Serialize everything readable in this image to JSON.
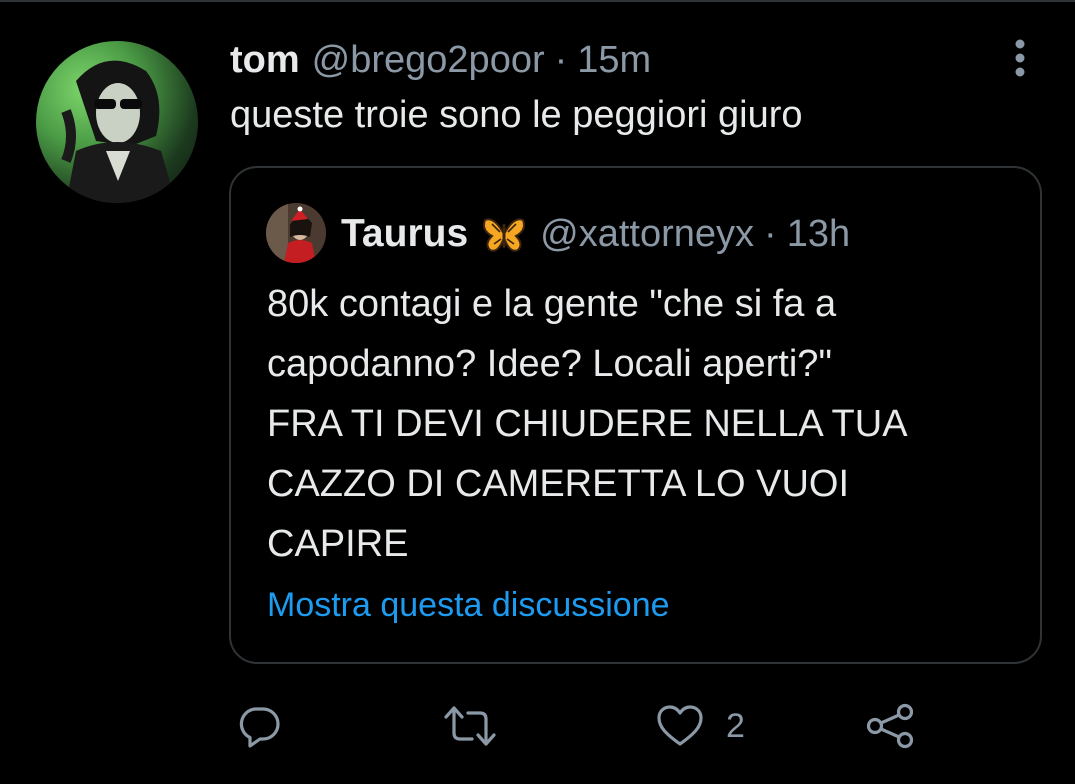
{
  "tweet": {
    "author_name": "tom",
    "author_handle": "@brego2poor",
    "separator": "·",
    "time": "15m",
    "text": "queste troie sono le peggiori giuro",
    "avatar_icon": "profile-photo",
    "more_icon": "vertical-dots-icon"
  },
  "quoted_tweet": {
    "author_name": "Taurus",
    "author_emoji": "butterfly-icon",
    "author_handle": "@xattorneyx",
    "separator": "·",
    "time": "13h",
    "lines": [
      "80k contagi e la gente \"che si fa a",
      "capodanno? Idee? Locali aperti?\"",
      "FRA TI DEVI CHIUDERE NELLA TUA",
      "CAZZO DI CAMERETTA LO VUOI",
      "CAPIRE"
    ],
    "show_thread_label": "Mostra questa discussione"
  },
  "actions": {
    "reply_icon": "reply-icon",
    "retweet_icon": "retweet-icon",
    "like_icon": "heart-icon",
    "like_count": "2",
    "share_icon": "share-icon"
  },
  "colors": {
    "background": "#000000",
    "text": "#e7e9ea",
    "secondary": "#8b98a5",
    "link": "#1d9bf0",
    "border": "#2f3336"
  }
}
